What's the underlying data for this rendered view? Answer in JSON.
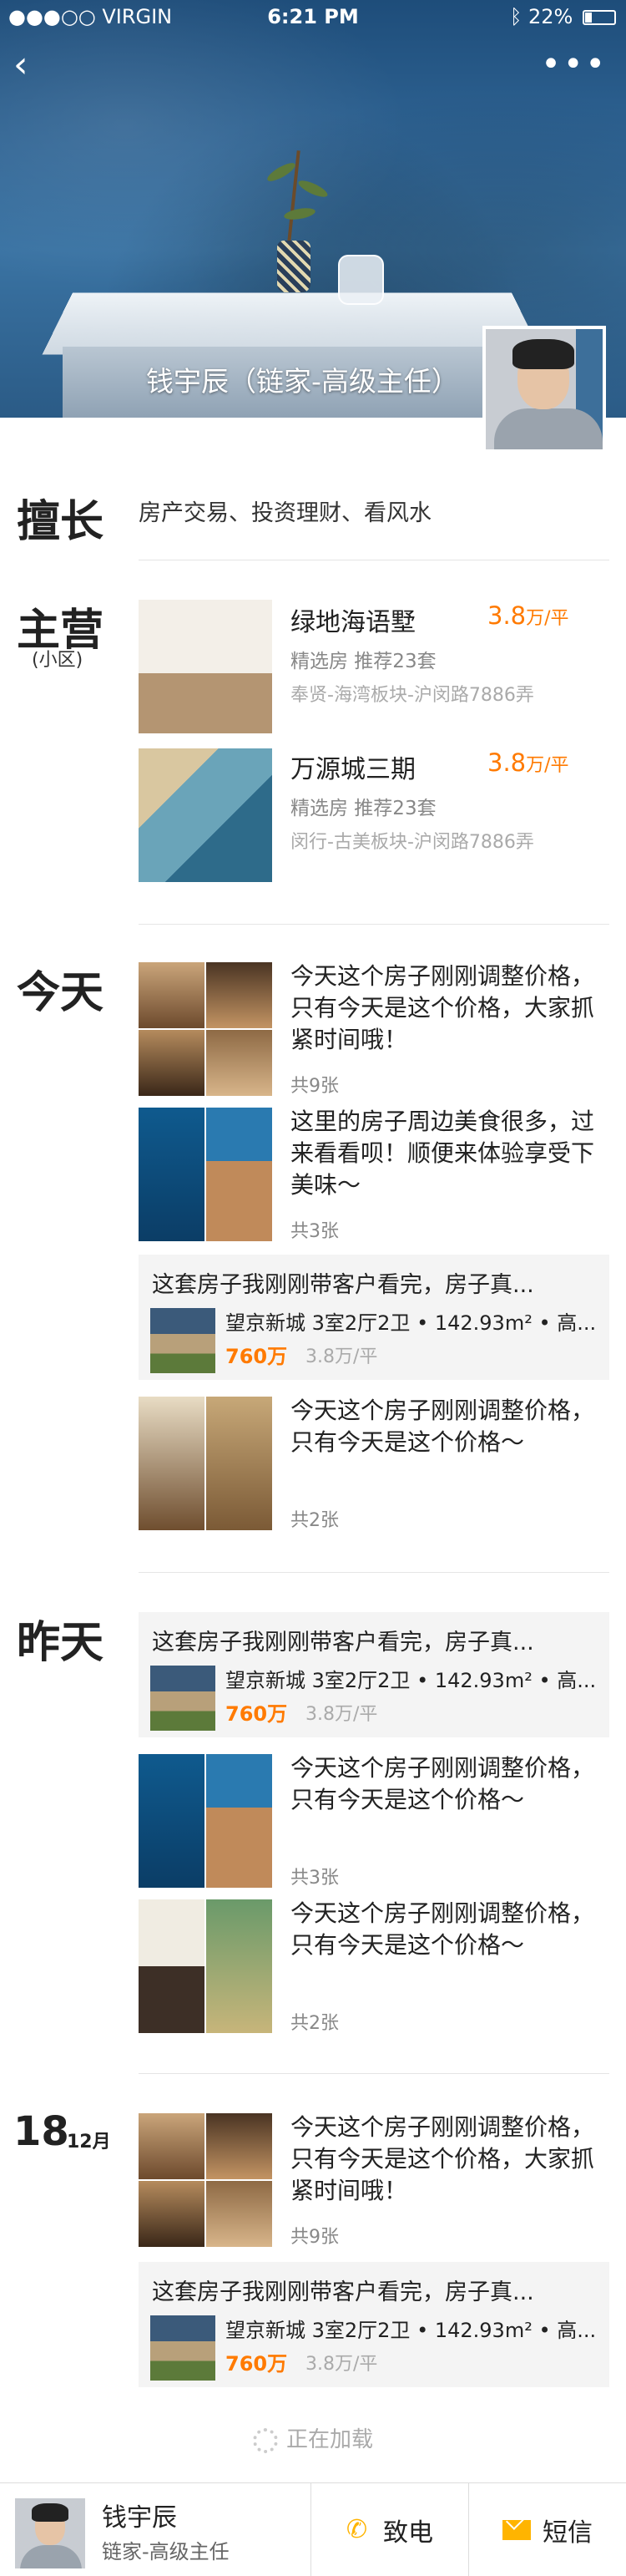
{
  "status_bar": {
    "carrier": "●●●○○ VIRGIN",
    "time": "6:21 PM",
    "battery": "22%"
  },
  "header": {
    "back_icon": "back-arrow-icon",
    "more_icon": "more-dots-icon",
    "agent_title": "钱宇辰（链家-高级主任）"
  },
  "specialty": {
    "label": "擅长",
    "text": "房产交易、投资理财、看风水"
  },
  "main_business": {
    "label": "主营",
    "sublabel": "(小区)",
    "items": [
      {
        "name": "绿地海语墅",
        "price": "3.8",
        "unit": "万/平",
        "tags": "精选房  推荐23套",
        "location": "奉贤-海湾板块-沪闵路7886弄"
      },
      {
        "name": "万源城三期",
        "price": "3.8",
        "unit": "万/平",
        "tags": "精选房  推荐23套",
        "location": "闵行-古美板块-沪闵路7886弄"
      }
    ]
  },
  "today": {
    "label": "今天",
    "posts": [
      {
        "text": "今天这个房子刚刚调整价格，只有今天是这个价格，大家抓紧时间哦！",
        "count": "共9张"
      },
      {
        "text": "这里的房子周边美食很多，过来看看呗！顺便来体验享受下美味〜",
        "count": "共3张"
      },
      {
        "text": "今天这个房子刚刚调整价格，只有今天是这个价格〜",
        "count": "共2张"
      }
    ],
    "card": {
      "title": "这套房子我刚刚带客户看完，房子真...",
      "info": "望京新城  3室2厅2卫 • 142.93m² • 高...",
      "price": "760万",
      "unit_price": "3.8万/平"
    }
  },
  "yesterday": {
    "label": "昨天",
    "card": {
      "title": "这套房子我刚刚带客户看完，房子真...",
      "info": "望京新城  3室2厅2卫 • 142.93m² • 高...",
      "price": "760万",
      "unit_price": "3.8万/平"
    },
    "posts": [
      {
        "text": "今天这个房子刚刚调整价格，只有今天是这个价格〜",
        "count": "共3张"
      },
      {
        "text": "今天这个房子刚刚调整价格，只有今天是这个价格〜",
        "count": "共2张"
      }
    ]
  },
  "dec18": {
    "day": "18",
    "month": "12月",
    "post": {
      "text": "今天这个房子刚刚调整价格，只有今天是这个价格，大家抓紧时间哦！",
      "count": "共9张"
    },
    "card": {
      "title": "这套房子我刚刚带客户看完，房子真...",
      "info": "望京新城  3室2厅2卫 • 142.93m² • 高...",
      "price": "760万",
      "unit_price": "3.8万/平"
    }
  },
  "loading": {
    "text": "正在加载"
  },
  "bottom_bar": {
    "name": "钱宇辰",
    "title": "链家-高级主任",
    "call_label": "致电",
    "sms_label": "短信"
  },
  "colors": {
    "accent": "#ff7a00",
    "icon_yellow": "#ffb400"
  }
}
